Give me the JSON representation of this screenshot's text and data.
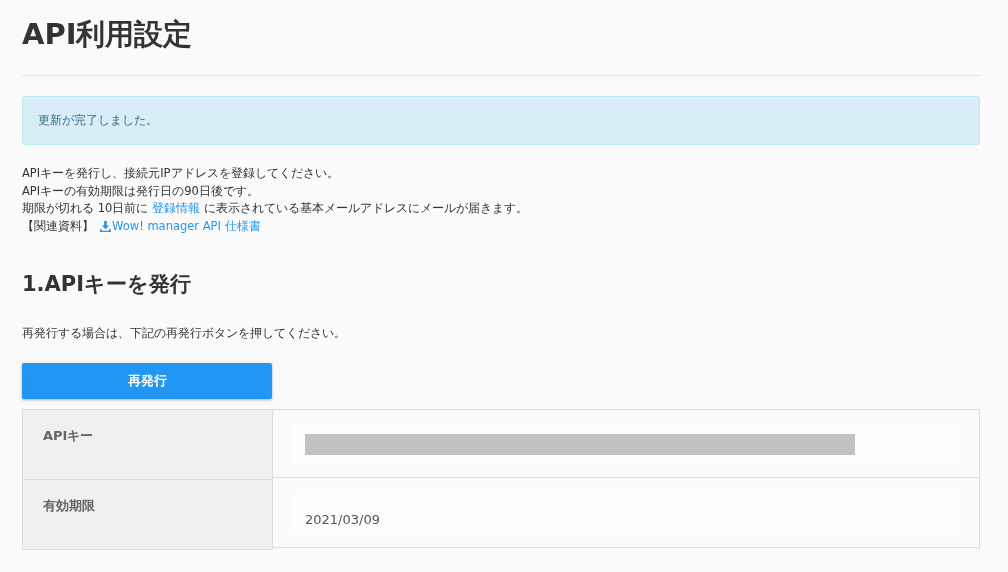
{
  "title": "API利用設定",
  "alert": "更新が完了しました。",
  "intro": {
    "lines": [
      "APIキーを発行し、接続元IPアドレスを登録してください。",
      "APIキーの有効期限は発行日の90日後です。"
    ],
    "notice": {
      "before": "期限が切れる 10日前に ",
      "link": "登録情報",
      "after": " に表示されている基本メールアドレスにメールが届きます。"
    },
    "related": {
      "label": "【関連資料】",
      "link": "Wow! manager API 仕様書"
    }
  },
  "section": {
    "heading": "1.APIキーを発行",
    "note": "再発行する場合は、下記の再発行ボタンを押してください。",
    "button": "再発行"
  },
  "table": {
    "rows": [
      {
        "label": "APIキー",
        "kind": "redacted"
      },
      {
        "label": "有効期限",
        "kind": "text",
        "value": "2021/03/09"
      }
    ]
  }
}
